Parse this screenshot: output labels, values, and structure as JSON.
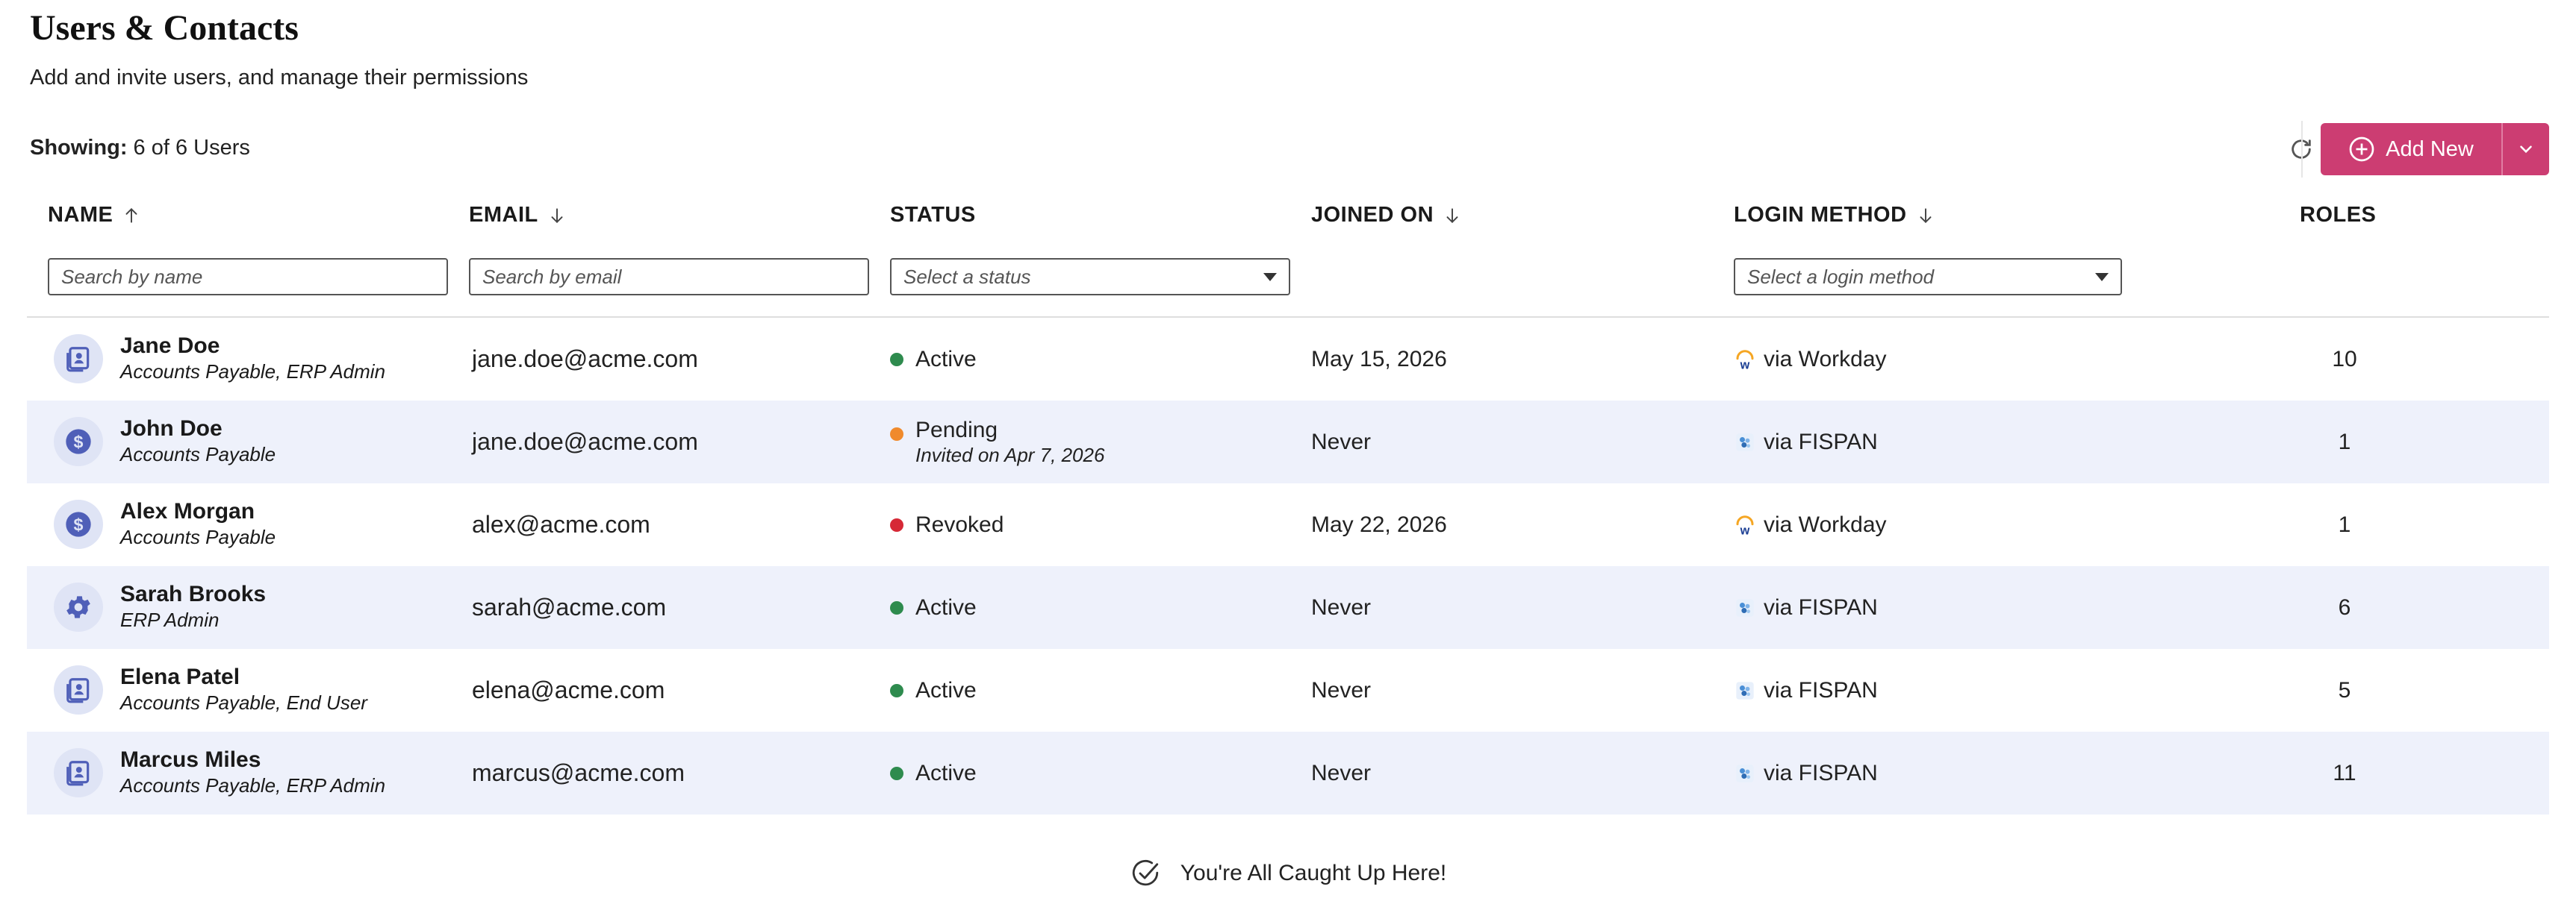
{
  "header": {
    "title": "Users & Contacts",
    "subtitle": "Add and invite users, and manage their permissions"
  },
  "toolbar": {
    "showing_label": "Showing:",
    "showing_value": "6 of 6 Users",
    "add_label": "Add New",
    "refresh_icon": "refresh-icon"
  },
  "columns": {
    "name": "NAME",
    "email": "EMAIL",
    "status": "STATUS",
    "joined": "JOINED ON",
    "login": "LOGIN METHOD",
    "roles": "ROLES"
  },
  "filters": {
    "name_placeholder": "Search by name",
    "email_placeholder": "Search by email",
    "status_placeholder": "Select a status",
    "login_placeholder": "Select a login method"
  },
  "rows": [
    {
      "name": "Jane Doe",
      "roles_text": "Accounts Payable, ERP Admin",
      "email": "jane.doe@acme.com",
      "status": "Active",
      "status_sub": "",
      "status_color": "#2e8b4e",
      "joined": "May 15, 2026",
      "login": "via Workday",
      "login_icon": "workday-icon",
      "roles_count": "10",
      "avatar_icon": "contact-card-icon"
    },
    {
      "name": "John Doe",
      "roles_text": "Accounts Payable",
      "email": "jane.doe@acme.com",
      "status": "Pending",
      "status_sub": "Invited on Apr 7, 2026",
      "status_color": "#f08a2c",
      "joined": "Never",
      "login": "via FISPAN",
      "login_icon": "fispan-icon",
      "roles_count": "1",
      "avatar_icon": "dollar-icon"
    },
    {
      "name": "Alex Morgan",
      "roles_text": "Accounts Payable",
      "email": "alex@acme.com",
      "status": "Revoked",
      "status_sub": "",
      "status_color": "#d62936",
      "joined": "May 22, 2026",
      "login": "via Workday",
      "login_icon": "workday-icon",
      "roles_count": "1",
      "avatar_icon": "dollar-icon"
    },
    {
      "name": "Sarah Brooks",
      "roles_text": "ERP Admin",
      "email": "sarah@acme.com",
      "status": "Active",
      "status_sub": "",
      "status_color": "#2e8b4e",
      "joined": "Never",
      "login": "via FISPAN",
      "login_icon": "fispan-icon",
      "roles_count": "6",
      "avatar_icon": "gear-icon"
    },
    {
      "name": "Elena Patel",
      "roles_text": "Accounts Payable, End User",
      "email": "elena@acme.com",
      "status": "Active",
      "status_sub": "",
      "status_color": "#2e8b4e",
      "joined": "Never",
      "login": "via FISPAN",
      "login_icon": "fispan-icon",
      "roles_count": "5",
      "avatar_icon": "contact-card-icon"
    },
    {
      "name": "Marcus Miles",
      "roles_text": "Accounts Payable, ERP Admin",
      "email": "marcus@acme.com",
      "status": "Active",
      "status_sub": "",
      "status_color": "#2e8b4e",
      "joined": "Never",
      "login": "via FISPAN",
      "login_icon": "fispan-icon",
      "roles_count": "11",
      "avatar_icon": "contact-card-icon"
    }
  ],
  "footer": {
    "message": "You're All Caught Up Here!",
    "icon": "check-circle-icon"
  },
  "colors": {
    "accent": "#cc3d72",
    "avatar_bg": "#dfe4f5",
    "avatar_icon": "#4f5fb8",
    "row_alt": "#eef1fb"
  }
}
